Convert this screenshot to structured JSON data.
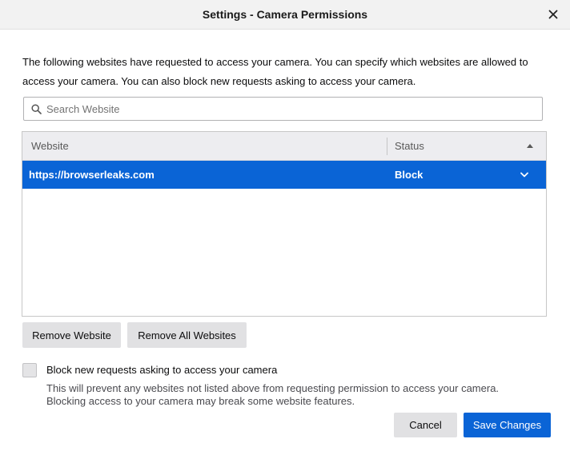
{
  "dialog": {
    "title": "Settings - Camera Permissions",
    "description": "The following websites have requested to access your camera. You can specify which websites are allowed to access your camera. You can also block new requests asking to access your camera."
  },
  "search": {
    "placeholder": "Search Website",
    "value": ""
  },
  "table": {
    "columns": [
      "Website",
      "Status"
    ],
    "rows": [
      {
        "website": "https://browserleaks.com",
        "status": "Block"
      }
    ]
  },
  "buttons": {
    "remove_website": "Remove Website",
    "remove_all": "Remove All Websites",
    "cancel": "Cancel",
    "save": "Save Changes"
  },
  "block_requests": {
    "label": "Block new requests asking to access your camera",
    "checked": false,
    "help_line1": "This will prevent any websites not listed above from requesting permission to access your camera.",
    "help_line2": "Blocking access to your camera may break some website features."
  },
  "icons": {
    "close": "close-icon",
    "search": "search-icon",
    "sort": "sort-ascending-icon",
    "dropdown": "chevron-down-icon"
  },
  "colors": {
    "accent": "#0a64d6",
    "button_grey": "#e1e1e3",
    "titlebar": "#f2f2f2"
  }
}
